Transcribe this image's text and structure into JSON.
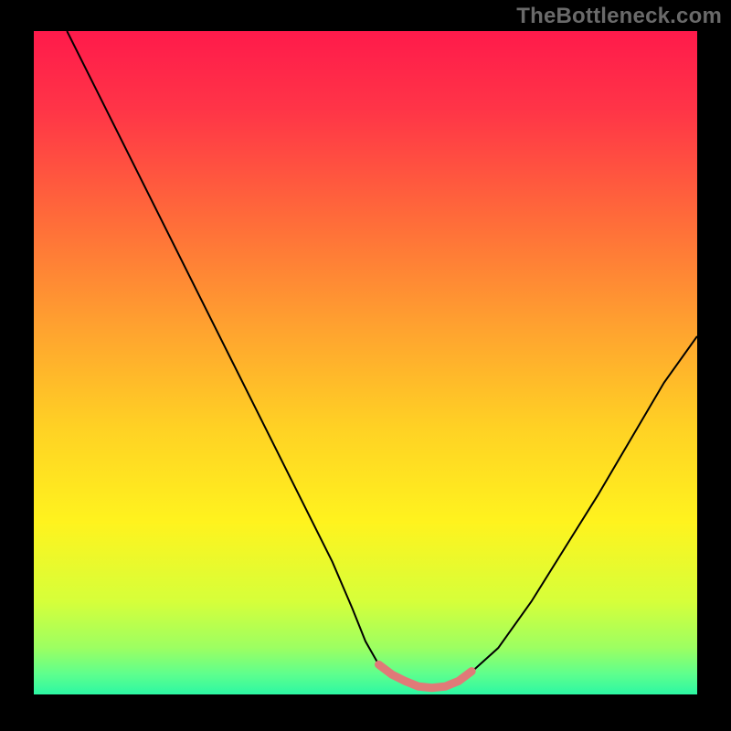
{
  "watermark": "TheBottleneck.com",
  "chart_data": {
    "type": "line",
    "title": "",
    "xlabel": "",
    "ylabel": "",
    "xlim": [
      0,
      100
    ],
    "ylim": [
      0,
      100
    ],
    "grid": false,
    "legend": false,
    "background_gradient": {
      "stops": [
        {
          "offset": 0.0,
          "color": "#ff1a4b"
        },
        {
          "offset": 0.12,
          "color": "#ff3547"
        },
        {
          "offset": 0.28,
          "color": "#ff6a3a"
        },
        {
          "offset": 0.45,
          "color": "#ffa32f"
        },
        {
          "offset": 0.6,
          "color": "#ffd224"
        },
        {
          "offset": 0.74,
          "color": "#fff31e"
        },
        {
          "offset": 0.86,
          "color": "#d6ff3a"
        },
        {
          "offset": 0.93,
          "color": "#9cff62"
        },
        {
          "offset": 0.97,
          "color": "#5dff8e"
        },
        {
          "offset": 1.0,
          "color": "#2cf7a3"
        }
      ]
    },
    "series": [
      {
        "name": "bottleneck-curve",
        "type": "line",
        "color": "#000000",
        "stroke_width": 2,
        "x": [
          5.0,
          10.0,
          15.0,
          20.0,
          25.0,
          30.0,
          35.0,
          40.0,
          45.0,
          48.0,
          50.0,
          52.0,
          55.0,
          58.0,
          60.0,
          62.0,
          65.0,
          70.0,
          75.0,
          80.0,
          85.0,
          90.0,
          95.0,
          100.0
        ],
        "y": [
          100.0,
          90.0,
          80.0,
          70.0,
          60.0,
          50.0,
          40.0,
          30.0,
          20.0,
          13.0,
          8.0,
          4.5,
          2.0,
          1.0,
          0.8,
          1.0,
          2.5,
          7.0,
          14.0,
          22.0,
          30.0,
          38.5,
          47.0,
          54.0
        ]
      },
      {
        "name": "low-bottleneck-highlight",
        "type": "line",
        "color": "#e07a78",
        "stroke_width": 9,
        "linecap": "round",
        "x": [
          52.0,
          54.0,
          56.0,
          58.0,
          60.0,
          62.0,
          64.0,
          66.0
        ],
        "y": [
          4.5,
          3.0,
          2.0,
          1.2,
          1.0,
          1.2,
          2.0,
          3.5
        ]
      }
    ]
  }
}
